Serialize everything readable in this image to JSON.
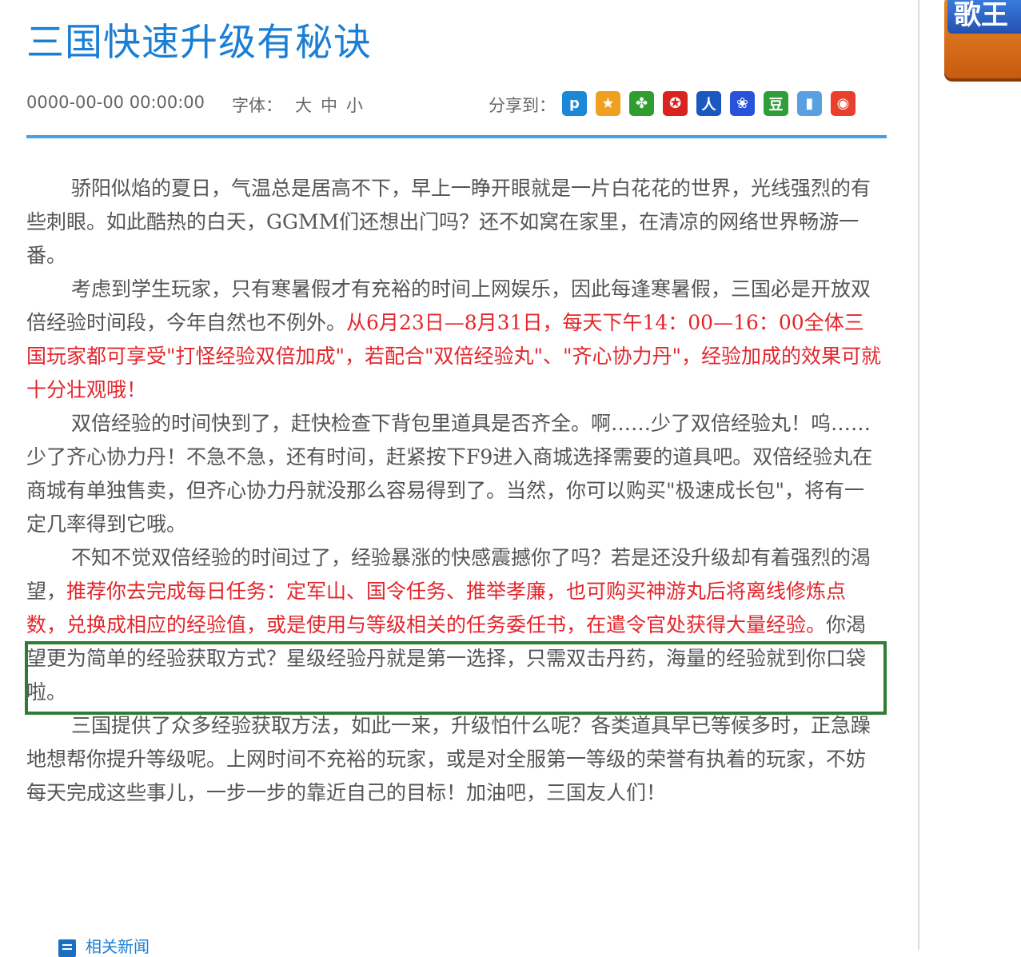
{
  "article": {
    "title": "三国快速升级有秘诀",
    "date": "0000-00-00 00:00:00",
    "font_label": "字体：",
    "font_sizes": [
      "大",
      "中",
      "小"
    ],
    "share_label": "分享到：",
    "share_icons": [
      {
        "name": "qzone-icon",
        "color": "#1a88d6",
        "glyph": "p"
      },
      {
        "name": "tencent-weibo-icon",
        "color": "#f0a020",
        "glyph": "★"
      },
      {
        "name": "kaixin-icon",
        "color": "#2e9e2e",
        "glyph": "✤"
      },
      {
        "name": "renren-icon",
        "color": "#d8231f",
        "glyph": "✪"
      },
      {
        "name": "people-icon",
        "color": "#1a58c0",
        "glyph": "人"
      },
      {
        "name": "baidu-icon",
        "color": "#2a52d8",
        "glyph": "❀"
      },
      {
        "name": "douban-icon",
        "color": "#2f9e3a",
        "glyph": "豆"
      },
      {
        "name": "bookmark-icon",
        "color": "#5aa0e0",
        "glyph": "▮"
      },
      {
        "name": "sina-weibo-icon",
        "color": "#e8402c",
        "glyph": "◉"
      }
    ],
    "paragraphs": [
      [
        {
          "text": "骄阳似焰的夏日，气温总是居高不下，早上一睁开眼就是一片白花花的世界，光线强烈的有些刺眼。如此酷热的白天，GGMM们还想出门吗？还不如窝在家里，在清凉的网络世界畅游一番。",
          "red": false
        }
      ],
      [
        {
          "text": "考虑到学生玩家，只有寒暑假才有充裕的时间上网娱乐，因此每逢寒暑假，三国必是开放双倍经验时间段，今年自然也不例外。",
          "red": false
        },
        {
          "text": "从6月23日—8月31日，每天下午14：00—16：00全体三国玩家都可享受\"打怪经验双倍加成\"，若配合\"双倍经验丸\"、\"齐心协力丹\"，经验加成的效果可就十分壮观哦！",
          "red": true
        }
      ],
      [
        {
          "text": "双倍经验的时间快到了，赶快检查下背包里道具是否齐全。啊……少了双倍经验丸！呜……少了齐心协力丹！不急不急，还有时间，赶紧按下F9进入商城选择需要的道具吧。双倍经验丸在商城有单独售卖，但齐心协力丹就没那么容易得到了。当然，你可以购买\"极速成长包\"，将有一定几率得到它哦。",
          "red": false
        }
      ],
      [
        {
          "text": "不知不觉双倍经验的时间过了，经验暴涨的快感震撼你了吗？若是还没升级却有着强烈的渴望，",
          "red": false
        },
        {
          "text": "推荐你去完成每日任务：定军山、国令任务、推举孝廉，也可购买神游丸后将离线修炼点数，兑换成相应的经验值，或是使用与等级相关的任务委任书，在遣令官处获得大量经验。",
          "red": true
        },
        {
          "text": "你渴望更为简单的经验获取方式？星级经验丹就是第一选择，只需双击丹药，海量的经验就到你口袋啦。",
          "red": false
        }
      ],
      [
        {
          "text": "三国提供了众多经验获取方法，如此一来，升级怕什么呢？各类道具早已等候多时，正急躁地想帮你提升等级呢。上网时间不充裕的玩家，或是对全服第一等级的荣誉有执着的玩家，不妨每天完成这些事儿，一步一步的靠近自己的目标！加油吧，三国友人们！",
          "red": false
        }
      ]
    ],
    "related_label": "相关新闻"
  },
  "sidebar": {
    "banner_text": "歌王"
  },
  "colors": {
    "title": "#1a7fd4",
    "highlight_text": "#e3262c",
    "rule": "#4a9fe0",
    "annotation_box": "#2e7d32"
  }
}
